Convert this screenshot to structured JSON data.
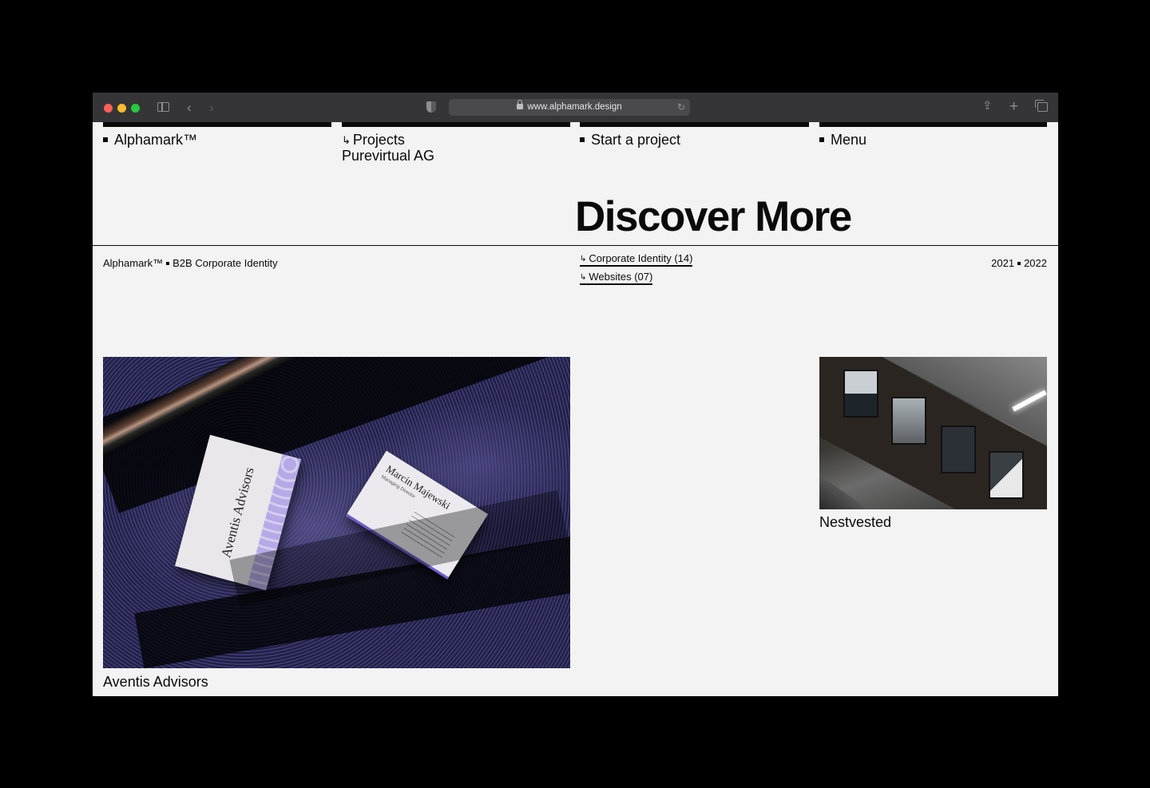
{
  "browser": {
    "url": "www.alphamark.design",
    "icons": {
      "sidebar": "sidebar-icon",
      "back": "chevron-left-icon",
      "forward": "chevron-right-icon",
      "privacy": "shield-icon",
      "lock": "lock-icon",
      "reload": "reload-icon",
      "share": "share-icon",
      "new_tab": "plus-icon",
      "tab_overview": "tabs-icon"
    },
    "traffic_lights": [
      "#fe5f57",
      "#febc2e",
      "#28c840"
    ]
  },
  "nav": {
    "brand": "Alphamark™",
    "projects_label": "Projects",
    "projects_sub": "Purevirtual AG",
    "start_project": "Start a project",
    "menu": "Menu"
  },
  "hero": {
    "heading": "Discover More"
  },
  "meta": {
    "left": "Alphamark™",
    "left_tail": "B2B Corporate Identity",
    "years_a": "2021",
    "years_b": "2022"
  },
  "filters": [
    {
      "label": "Corporate Identity (14)"
    },
    {
      "label": "Websites (07)"
    }
  ],
  "projects": [
    {
      "title": "Aventis Advisors",
      "card_front": "Aventis Advisors",
      "card_name": "Marcin Majewski",
      "card_role": "Managing Director"
    },
    {
      "title": "Nestvested"
    }
  ],
  "colors": {
    "page_bg": "#f3f3f3",
    "ink": "#0a0a0a",
    "chrome": "#353537",
    "accent_violet": "#6d5bd0"
  }
}
